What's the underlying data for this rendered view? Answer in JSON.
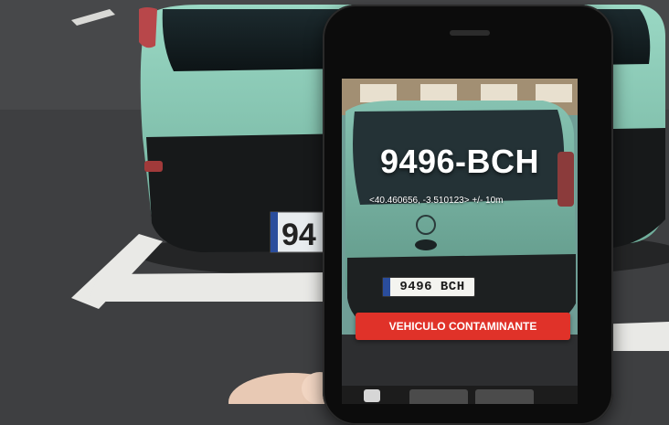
{
  "scene": {
    "description_colors": {
      "car_body": "#8cc9b5",
      "asphalt": "#3e3f41",
      "parking_line": "#e9e9e6",
      "phone_frame": "#0c0c0c",
      "alert_red": "#e03229"
    }
  },
  "real_plate": {
    "visible_text": "94"
  },
  "app": {
    "plate_readout": "9496-BCH",
    "gps_readout": "<40.460656, -3.510123> +/- 10m",
    "plate_detected": "9496 BCH",
    "alert_label": "VEHICULO CONTAMINANTE",
    "toolbar": {
      "icons": [
        "camera-icon"
      ]
    }
  }
}
